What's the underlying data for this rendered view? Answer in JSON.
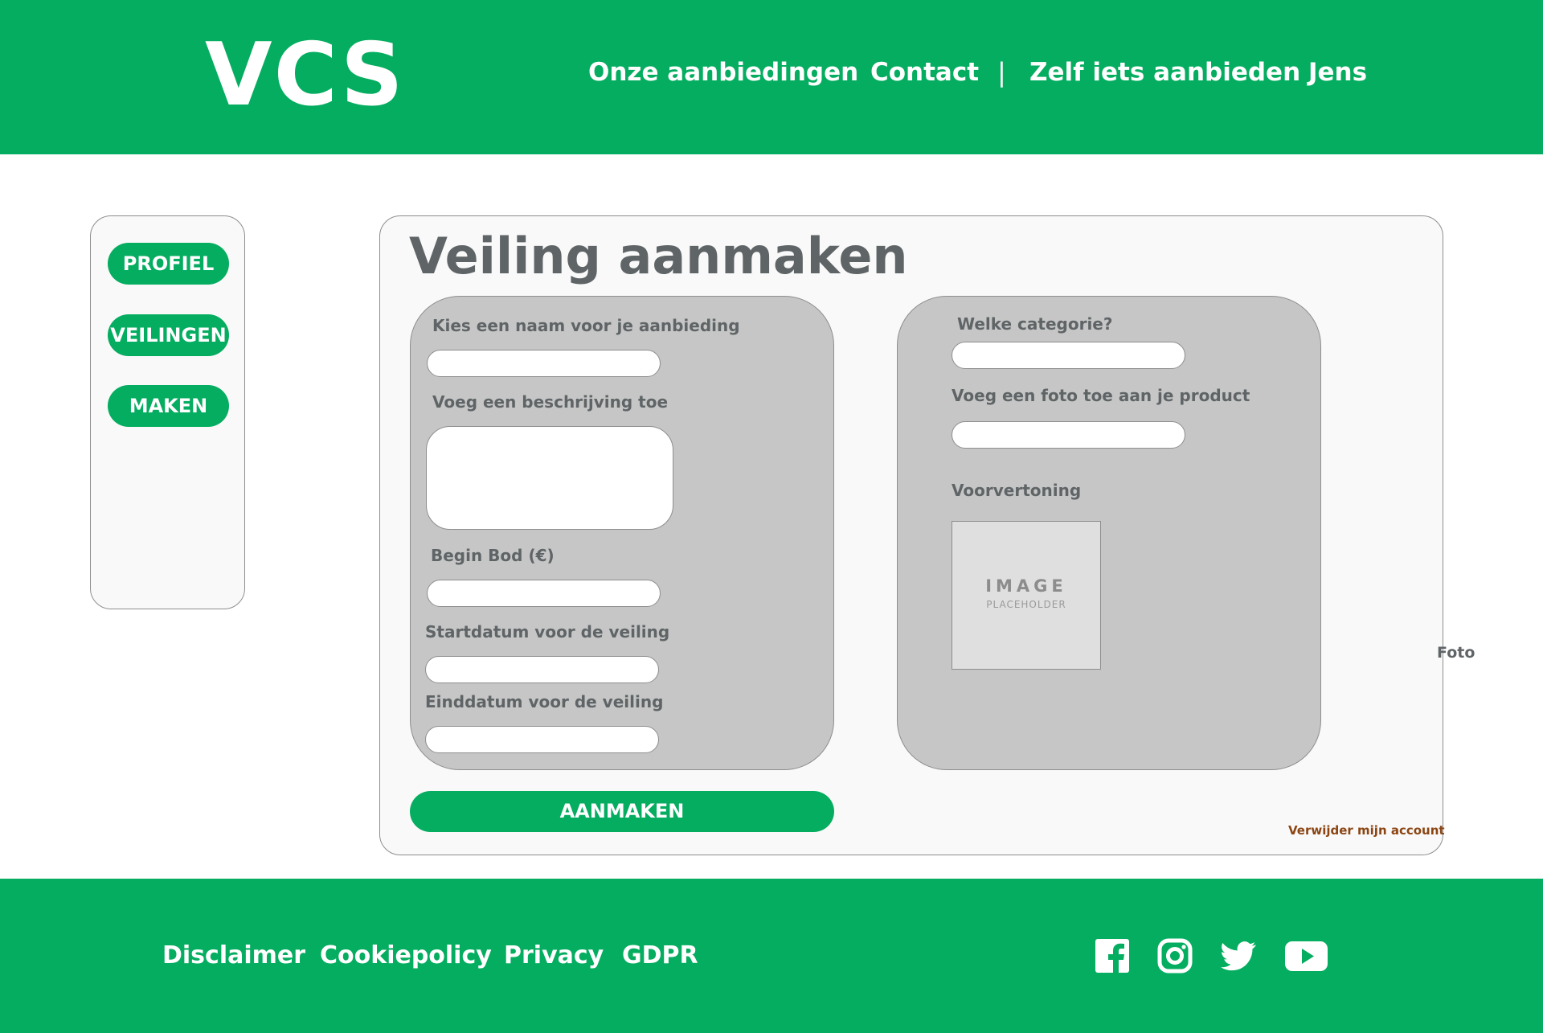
{
  "header": {
    "logo": "VCS",
    "nav": {
      "offers": "Onze aanbiedingen",
      "contact": "Contact",
      "separator": "|",
      "offer_yourself": "Zelf iets aanbieden",
      "user": "Jens"
    }
  },
  "sidebar": {
    "items": [
      {
        "label": "PROFIEL"
      },
      {
        "label": "VEILINGEN"
      },
      {
        "label": "MAKEN"
      }
    ]
  },
  "form": {
    "title": "Veiling aanmaken",
    "left": {
      "name_label": "Kies een naam voor je aanbieding",
      "description_label": "Voeg een beschrijving toe",
      "start_bid_label": "Begin Bod (€)",
      "start_date_label": "Startdatum voor de veiling",
      "end_date_label": "Einddatum voor de veiling"
    },
    "right": {
      "category_label": "Welke categorie?",
      "photo_label": "Voeg een foto toe aan je product",
      "preview_label": "Voorvertoning",
      "placeholder_main": "IMAGE",
      "placeholder_sub": "PLACEHOLDER"
    },
    "submit_label": "AANMAKEN",
    "delete_account": "Verwijder mijn account",
    "foto_note": "Foto"
  },
  "footer": {
    "links": [
      "Disclaimer",
      "Cookiepolicy",
      "Privacy",
      "GDPR"
    ],
    "social": [
      "facebook-icon",
      "instagram-icon",
      "twitter-icon",
      "youtube-icon"
    ]
  },
  "colors": {
    "brand_green": "#05ad60",
    "panel_gray": "#c6c6c6",
    "title_gray": "#5f6466",
    "danger_brown": "#8b4513"
  }
}
